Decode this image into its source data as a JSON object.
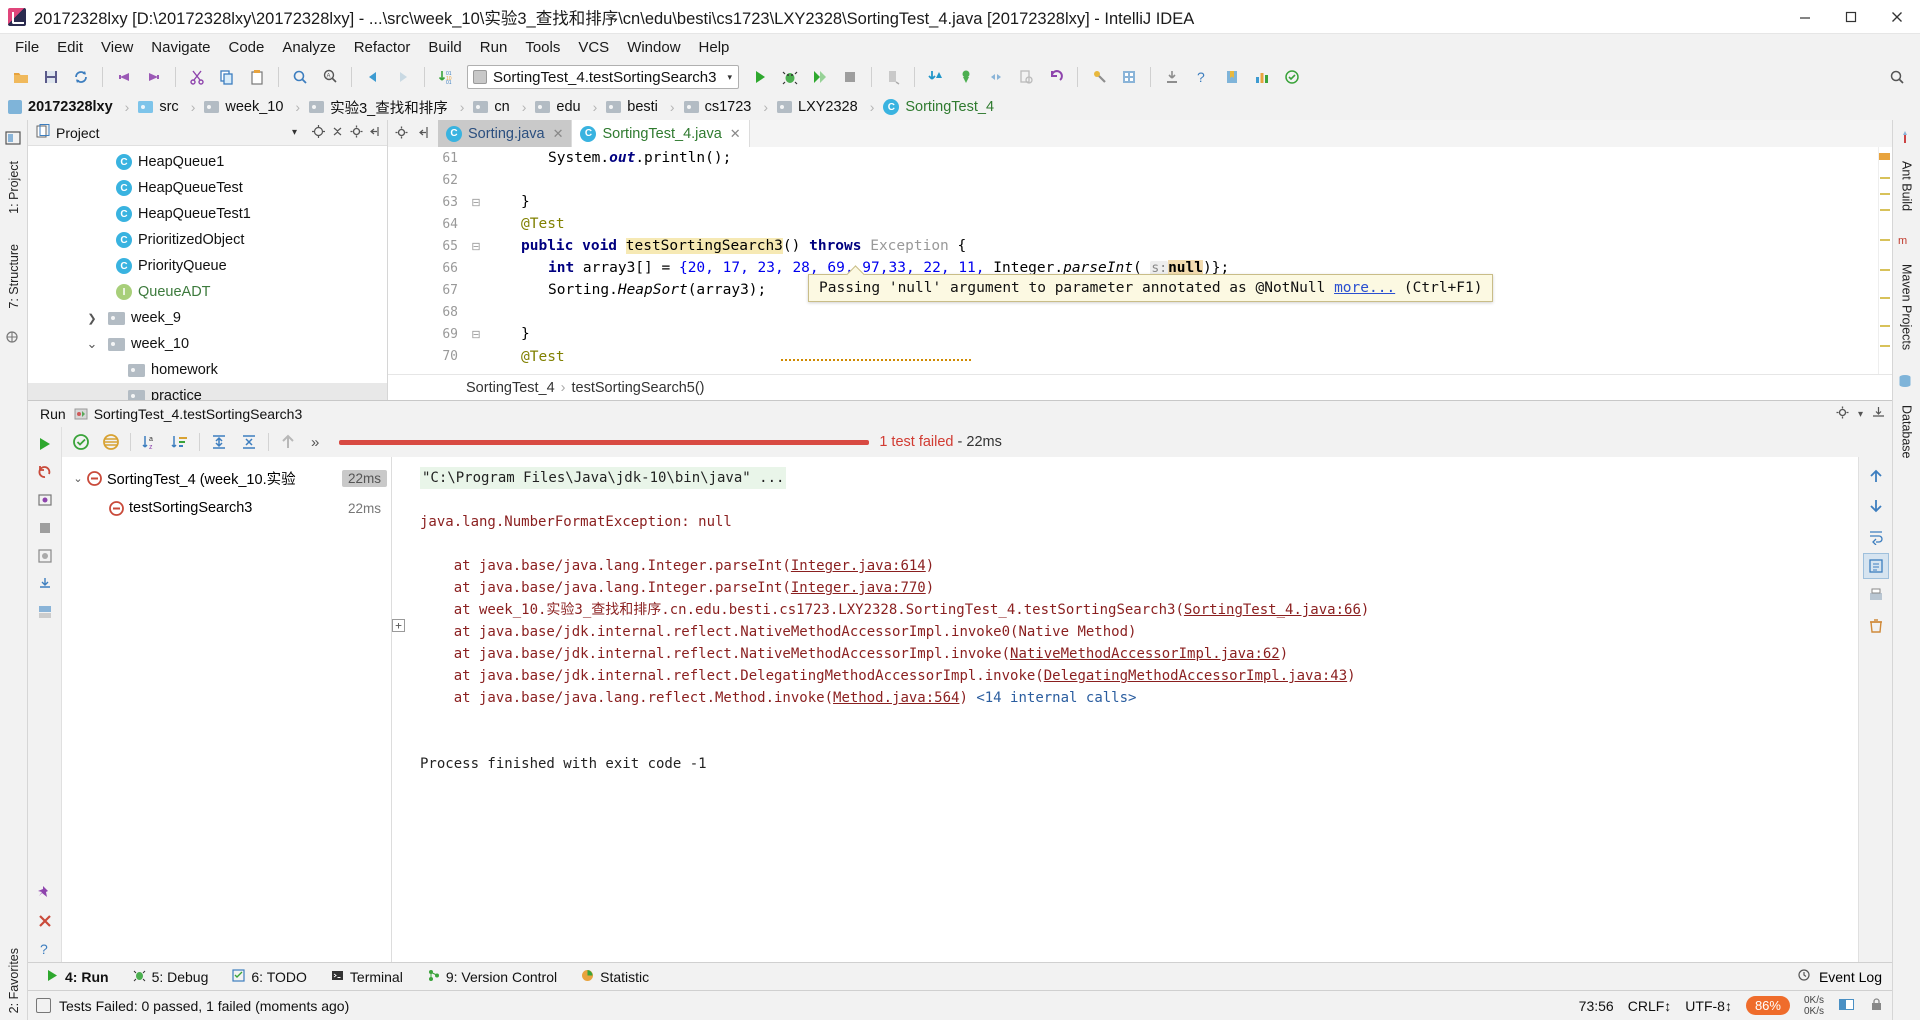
{
  "window": {
    "title": "20172328lxy [D:\\20172328lxy\\20172328lxy] - ...\\src\\week_10\\实验3_查找和排序\\cn\\edu\\besti\\cs1723\\LXY2328\\SortingTest_4.java [20172328lxy] - IntelliJ IDEA",
    "app_icon": "intellij-idea-icon",
    "minimize": "–",
    "maximize": "▢",
    "close": "✕"
  },
  "menubar": {
    "items": [
      "File",
      "Edit",
      "View",
      "Navigate",
      "Code",
      "Analyze",
      "Refactor",
      "Build",
      "Run",
      "Tools",
      "VCS",
      "Window",
      "Help"
    ]
  },
  "toolbar": {
    "icons": [
      "open-folder-icon",
      "save-all-icon",
      "sync-icon",
      "undo-icon",
      "redo-icon",
      "cut-icon",
      "copy-icon",
      "paste-icon",
      "find-icon",
      "replace-icon",
      "back-icon",
      "forward-icon",
      "compile-icon"
    ],
    "run_config": {
      "label": "SortingTest_4.testSortingSearch3",
      "caret": "▾"
    },
    "right_icons": [
      "run-icon",
      "debug-icon",
      "run-coverage-icon",
      "stop-icon",
      "profile-icon",
      "update-project-icon",
      "commit-icon",
      "diff-icon",
      "push-icon",
      "revert-icon",
      "settings-icon",
      "project-structure-icon",
      "download-icon",
      "help-icon",
      "bookmark-icon",
      "chart-icon",
      "inspect-icon",
      "search-everywhere-icon"
    ]
  },
  "breadcrumb": {
    "items": [
      {
        "label": "20172328lxy",
        "icon": "module-icon"
      },
      {
        "label": "src",
        "icon": "source-folder-icon"
      },
      {
        "label": "week_10",
        "icon": "folder-icon"
      },
      {
        "label": "实验3_查找和排序",
        "icon": "folder-icon"
      },
      {
        "label": "cn",
        "icon": "folder-icon"
      },
      {
        "label": "edu",
        "icon": "folder-icon"
      },
      {
        "label": "besti",
        "icon": "folder-icon"
      },
      {
        "label": "cs1723",
        "icon": "folder-icon"
      },
      {
        "label": "LXY2328",
        "icon": "folder-icon"
      },
      {
        "label": "SortingTest_4",
        "icon": "class-icon"
      }
    ],
    "separator": "›"
  },
  "left_rail": {
    "tabs": [
      "1: Project",
      "7: Structure"
    ],
    "icons": [
      "project-tool-icon",
      "favorites-icon"
    ],
    "favorites_label": "2: Favorites"
  },
  "right_rail": {
    "tabs": [
      "Ant Build",
      "Maven Projects",
      "Database"
    ]
  },
  "project_panel": {
    "title": "Project",
    "header_icons": [
      "project-view-icon",
      "collapse-dropdown-icon",
      "locate-icon",
      "expand-collapse-icon",
      "gear-icon",
      "hide-icon"
    ],
    "tree": [
      {
        "label": "HeapQueue1",
        "icon": "class-icon",
        "indent": 3,
        "arrow": "",
        "style": "normal"
      },
      {
        "label": "HeapQueueTest",
        "icon": "class-run-icon",
        "indent": 3,
        "arrow": "",
        "style": "normal"
      },
      {
        "label": "HeapQueueTest1",
        "icon": "class-run-icon",
        "indent": 3,
        "arrow": "",
        "style": "normal"
      },
      {
        "label": "PrioritizedObject",
        "icon": "class-icon",
        "indent": 3,
        "arrow": "",
        "style": "normal"
      },
      {
        "label": "PriorityQueue",
        "icon": "class-icon",
        "indent": 3,
        "arrow": "",
        "style": "normal"
      },
      {
        "label": "QueueADT",
        "icon": "interface-icon",
        "indent": 3,
        "arrow": "",
        "style": "green"
      },
      {
        "label": "week_9",
        "icon": "folder-icon",
        "indent": 2,
        "arrow": "›",
        "style": "normal"
      },
      {
        "label": "week_10",
        "icon": "folder-icon",
        "indent": 2,
        "arrow": "⌄",
        "style": "normal"
      },
      {
        "label": "homework",
        "icon": "folder-icon",
        "indent": 3,
        "arrow": "",
        "style": "normal"
      },
      {
        "label": "practice",
        "icon": "folder-icon",
        "indent": 3,
        "arrow": "",
        "style": "normal"
      }
    ]
  },
  "editor": {
    "tabs": [
      {
        "label": "Sorting.java",
        "icon": "class-icon",
        "active": false,
        "close": "✕"
      },
      {
        "label": "SortingTest_4.java",
        "icon": "class-run-icon",
        "active": true,
        "close": "✕"
      }
    ],
    "left_icons": [
      "gear-icon",
      "hide-icon"
    ],
    "lines": [
      {
        "no": "61",
        "fold": "",
        "gutter_icon": ""
      },
      {
        "no": "62",
        "fold": "",
        "gutter_icon": ""
      },
      {
        "no": "63",
        "fold": "⊟",
        "gutter_icon": ""
      },
      {
        "no": "64",
        "fold": "",
        "gutter_icon": ""
      },
      {
        "no": "65",
        "fold": "⊟",
        "gutter_icon": "run-test-failed-icon"
      },
      {
        "no": "66",
        "fold": "",
        "gutter_icon": ""
      },
      {
        "no": "67",
        "fold": "",
        "gutter_icon": ""
      },
      {
        "no": "68",
        "fold": "",
        "gutter_icon": ""
      },
      {
        "no": "69",
        "fold": "⊟",
        "gutter_icon": ""
      },
      {
        "no": "70",
        "fold": "",
        "gutter_icon": ""
      }
    ],
    "code": {
      "l61": "System.out.println();",
      "l63": "}",
      "l64": "@Test",
      "l65_a": "public void ",
      "l65_name": "testSortingSearch3",
      "l65_b": "() ",
      "l65_throws": "throws ",
      "l65_exc": "Exception",
      "l65_brace": " {",
      "l66_kw": "int",
      "l66_var": " array3[] = ",
      "l66_vals": "{20, 17, 23, 28, 69, 97,33, 22, 11, ",
      "l66_cls": "Integer.",
      "l66_mth": "parseInt",
      "l66_paren": "( ",
      "l66_hint": "s:",
      "l66_null": "null",
      "l66_end": ")};",
      "l67": "Sorting.HeapSort(array3);",
      "l69": "}",
      "l70": "@Test"
    },
    "tooltip": {
      "text": "Passing 'null' argument to parameter annotated as @NotNull ",
      "link": "more...",
      "shortcut": " (Ctrl+F1)"
    },
    "breadcrumb": {
      "class": "SortingTest_4",
      "separator": "›",
      "method": "testSortingSearch5()"
    }
  },
  "run_panel": {
    "header": {
      "label": "Run",
      "config": "SortingTest_4.testSortingSearch3",
      "icon": "run-config-icon",
      "right_icons": [
        "gear-icon",
        "hide-icon"
      ]
    },
    "left_toolbar_icons": [
      "rerun-icon",
      "rerun-failed-icon",
      "toggle-auto-test-icon",
      "stop-icon",
      "dump-threads-icon",
      "close-icon",
      "export-icon",
      "pin-icon",
      "delete-icon",
      "help-icon"
    ],
    "test_toolbar_icons": [
      "show-passed-icon",
      "show-ignored-icon",
      "sort-alphabetically-icon",
      "sort-duration-icon",
      "expand-all-icon",
      "collapse-all-icon",
      "prev-failed-icon"
    ],
    "more_button": "»",
    "status": {
      "failed_text": "1 test failed",
      "duration": "- 22ms",
      "progress_color": "#d84a42"
    },
    "test_tree": [
      {
        "label": "SortingTest_4 (week_10.实验",
        "time": "22ms",
        "arrow": "⌄",
        "icon": "test-failed-icon",
        "selected": true
      },
      {
        "label": "testSortingSearch3",
        "time": "22ms",
        "arrow": "",
        "icon": "test-failed-icon",
        "selected": false
      }
    ],
    "console": [
      {
        "text": "\"C:\\Program Files\\Java\\jdk-10\\bin\\java\" ...",
        "type": "cmd"
      },
      {
        "text": "",
        "type": "blank"
      },
      {
        "text": "java.lang.NumberFormatException: null",
        "type": "exc"
      },
      {
        "text": "",
        "type": "blank"
      },
      {
        "text": "    at java.base/java.lang.Integer.parseInt(Integer.java:614)",
        "type": "trace",
        "link": "Integer.java:614"
      },
      {
        "text": "    at java.base/java.lang.Integer.parseInt(Integer.java:770)",
        "type": "trace",
        "link": "Integer.java:770"
      },
      {
        "text": "    at week_10.实验3_查找和排序.cn.edu.besti.cs1723.LXY2328.SortingTest_4.testSortingSearch3(SortingTest_4.java:66)",
        "type": "trace",
        "link": "SortingTest_4.java:66"
      },
      {
        "text": "    at java.base/jdk.internal.reflect.NativeMethodAccessorImpl.invoke0(Native Method)",
        "type": "trace",
        "link": ""
      },
      {
        "text": "    at java.base/jdk.internal.reflect.NativeMethodAccessorImpl.invoke(NativeMethodAccessorImpl.java:62)",
        "type": "trace",
        "link": "NativeMethodAccessorImpl.java:62"
      },
      {
        "text": "    at java.base/jdk.internal.reflect.DelegatingMethodAccessorImpl.invoke(DelegatingMethodAccessorImpl.java:43)",
        "type": "trace",
        "link": "DelegatingMethodAccessorImpl.java:43"
      },
      {
        "text": "    at java.base/java.lang.reflect.Method.invoke(Method.java:564) <14 internal calls>",
        "type": "trace",
        "link": "Method.java:564"
      },
      {
        "text": "",
        "type": "blank"
      },
      {
        "text": "",
        "type": "blank"
      },
      {
        "text": "Process finished with exit code -1",
        "type": "ok"
      }
    ],
    "console_fold_marker": "+",
    "console_rail_icons": [
      "scroll-up-icon",
      "scroll-down-icon",
      "soft-wrap-icon",
      "scroll-to-end-icon",
      "print-icon",
      "clear-all-icon"
    ]
  },
  "bottom_tabs": {
    "items": [
      {
        "label": "4: Run",
        "icon": "run-icon",
        "active": true
      },
      {
        "label": "5: Debug",
        "icon": "debug-icon",
        "active": false
      },
      {
        "label": "6: TODO",
        "icon": "todo-icon",
        "active": false
      },
      {
        "label": "Terminal",
        "icon": "terminal-icon",
        "active": false
      },
      {
        "label": "9: Version Control",
        "icon": "vcs-icon",
        "active": false
      },
      {
        "label": "Statistic",
        "icon": "statistic-icon",
        "active": false
      }
    ],
    "event_log": {
      "label": "Event Log",
      "icon": "event-log-icon"
    }
  },
  "statusbar": {
    "message": "Tests Failed: 0 passed, 1 failed (moments ago)",
    "position": "73:56",
    "line_sep": "CRLF↕",
    "encoding": "UTF-8↕",
    "memory": "86%",
    "net_up": "0K/s",
    "net_down": "0K/s",
    "right_icons": [
      "split-icon",
      "lock-icon"
    ]
  }
}
